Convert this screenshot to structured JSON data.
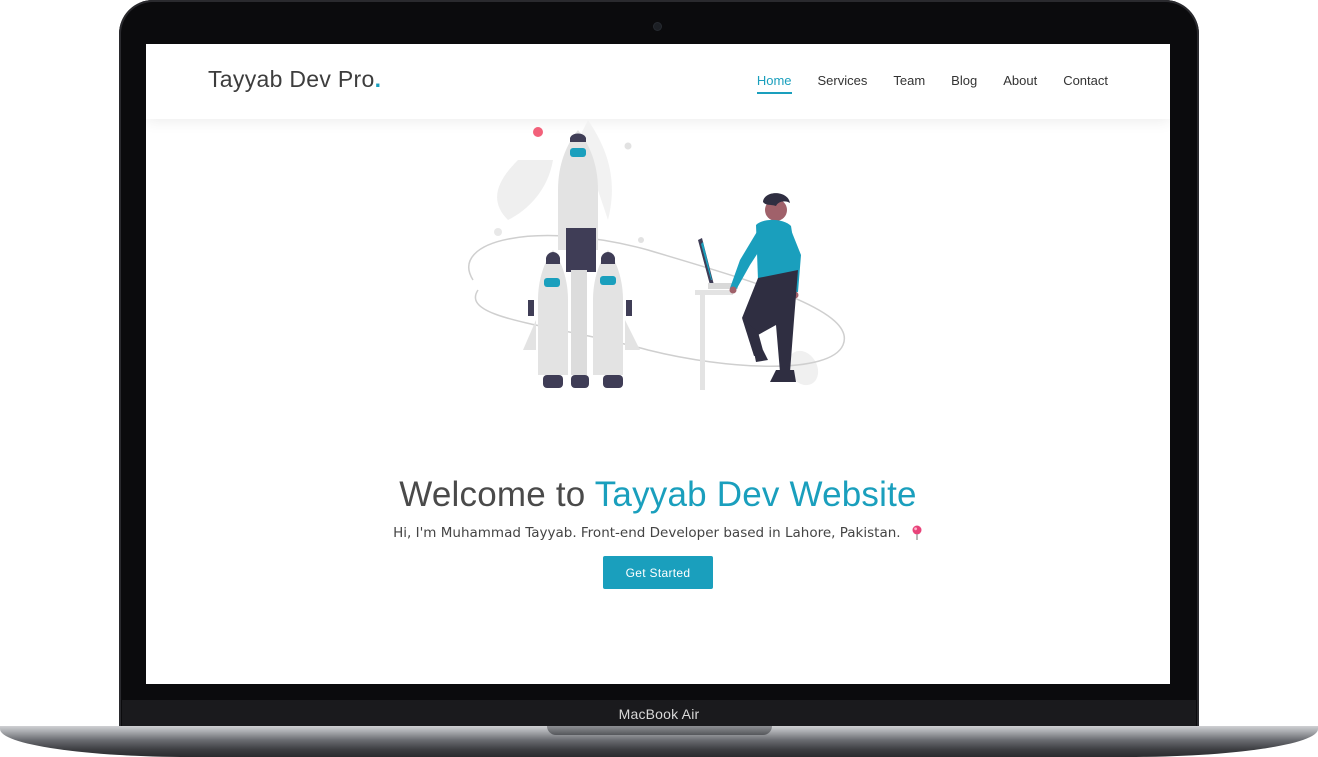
{
  "device": {
    "label": "MacBook Air"
  },
  "navbar": {
    "brand": "Tayyab Dev Pro",
    "brand_dot": ".",
    "items": [
      {
        "label": "Home",
        "active": true
      },
      {
        "label": "Services"
      },
      {
        "label": "Team"
      },
      {
        "label": "Blog"
      },
      {
        "label": "About"
      },
      {
        "label": "Contact"
      }
    ]
  },
  "hero": {
    "title_prefix": "Welcome to ",
    "title_accent": "Tayyab Dev Website",
    "subtitle": "Hi, I'm Muhammad Tayyab. Front-end Developer based in Lahore, Pakistan.",
    "cta_label": "Get Started",
    "illustration_icon": "rocket-launch-developer-illustration",
    "pin_icon": "map-pin-icon"
  },
  "colors": {
    "accent": "#1a9fbd",
    "text": "#4a4a4a",
    "rocket_body": "#e5e5e5",
    "rocket_dark": "#3f3d56",
    "shirt": "#1a9fbd",
    "pink_dot": "#f2617a"
  }
}
